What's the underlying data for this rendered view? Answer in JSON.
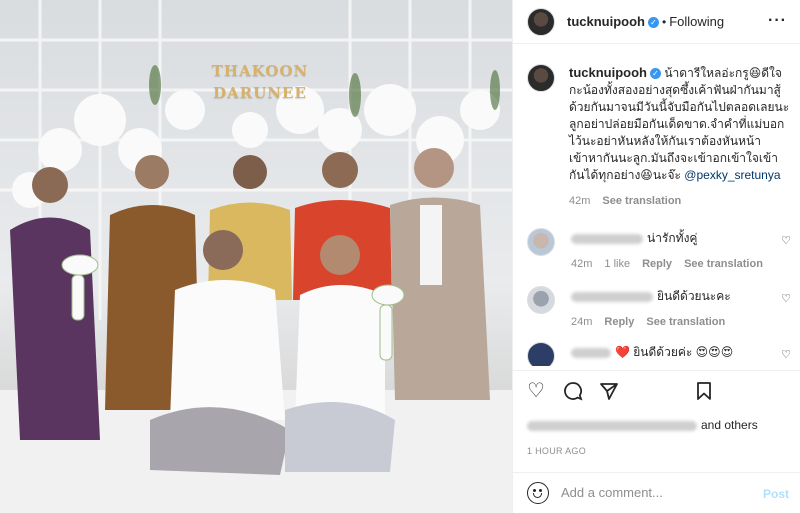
{
  "photo": {
    "sign_line1": "THAKOON",
    "sign_line2": "DARUNEE"
  },
  "header": {
    "username": "tucknuipooh",
    "separator": "•",
    "follow_label": "Following",
    "more_icon": "ellipsis-icon"
  },
  "caption": {
    "username": "tucknuipooh",
    "text": "น้าดารีใหลอ่ะกรู😆ดีใจกะน้องทั้งสองอย่างสุดซึ้งเค้าฟันฝ่ากันมาสู้ด้วยกันมาจนมีวันนี้จับมือกันไปตลอดเลยนะลูกอย่าปล่อยมือกันเด็ดขาด.จำคำที่แม่บอกไว้นะอย่าหันหลังให้กันเราต้องหันหน้าเข้าหากันนะลูก.มันถึงจะเข้าอกเข้าใจเข้ากันได้ทุกอย่าง😆นะจ๊ะ",
    "mention": "@pexky_sretunya",
    "time": "42m",
    "translate": "See translation"
  },
  "comments": [
    {
      "text": "น่ารักทั้งคู่",
      "time": "42m",
      "likes": "1 like",
      "reply": "Reply",
      "translate": "See translation"
    },
    {
      "text": "ยินดีด้วยนะคะ",
      "time": "24m",
      "reply": "Reply",
      "translate": "See translation"
    },
    {
      "text": "❤️ ยินดีด้วยค่ะ 😍😍😍"
    }
  ],
  "likes": {
    "suffix": "and others"
  },
  "timestamp": "1 HOUR AGO",
  "add_comment": {
    "placeholder": "Add a comment...",
    "post_label": "Post"
  },
  "colors": {
    "verified": "#3897f0",
    "mention": "#00376b",
    "post_disabled": "#b2dffc"
  }
}
